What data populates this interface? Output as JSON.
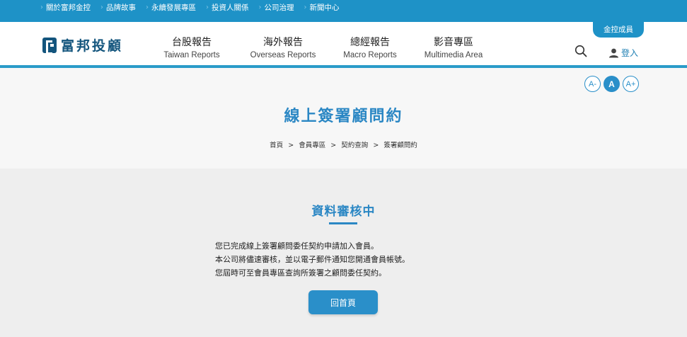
{
  "top_nav": [
    "關於富邦金控",
    "品牌故事",
    "永續發展專區",
    "投資人關係",
    "公司治理",
    "新聞中心"
  ],
  "brand": {
    "name": "富邦投顧"
  },
  "main_nav": [
    {
      "zh": "台股報告",
      "en": "Taiwan Reports"
    },
    {
      "zh": "海外報告",
      "en": "Overseas Reports"
    },
    {
      "zh": "總經報告",
      "en": "Macro Reports"
    },
    {
      "zh": "影音專區",
      "en": "Multimedia Area"
    }
  ],
  "group_tab": "金控成員",
  "login_label": "登入",
  "font_size_buttons": [
    "A-",
    "A",
    "A+"
  ],
  "page_title": "線上簽署顧問約",
  "breadcrumb": [
    "首頁",
    "會員專區",
    "契約查詢",
    "簽署顧問約"
  ],
  "section": {
    "title": "資料審核中",
    "lines": [
      "您已完成線上簽署顧問委任契約申請加入會員。",
      "本公司將儘速審核，並以電子郵件通知您開通會員帳號。",
      "您屆時可至會員專區查詢所簽署之顧問委任契約。"
    ],
    "button": "回首頁"
  },
  "colors": {
    "accent": "#2b87c4",
    "topbar": "#1e92c7",
    "brand": "#13557d"
  },
  "icons": {
    "search": "search-icon",
    "user": "user-icon"
  }
}
